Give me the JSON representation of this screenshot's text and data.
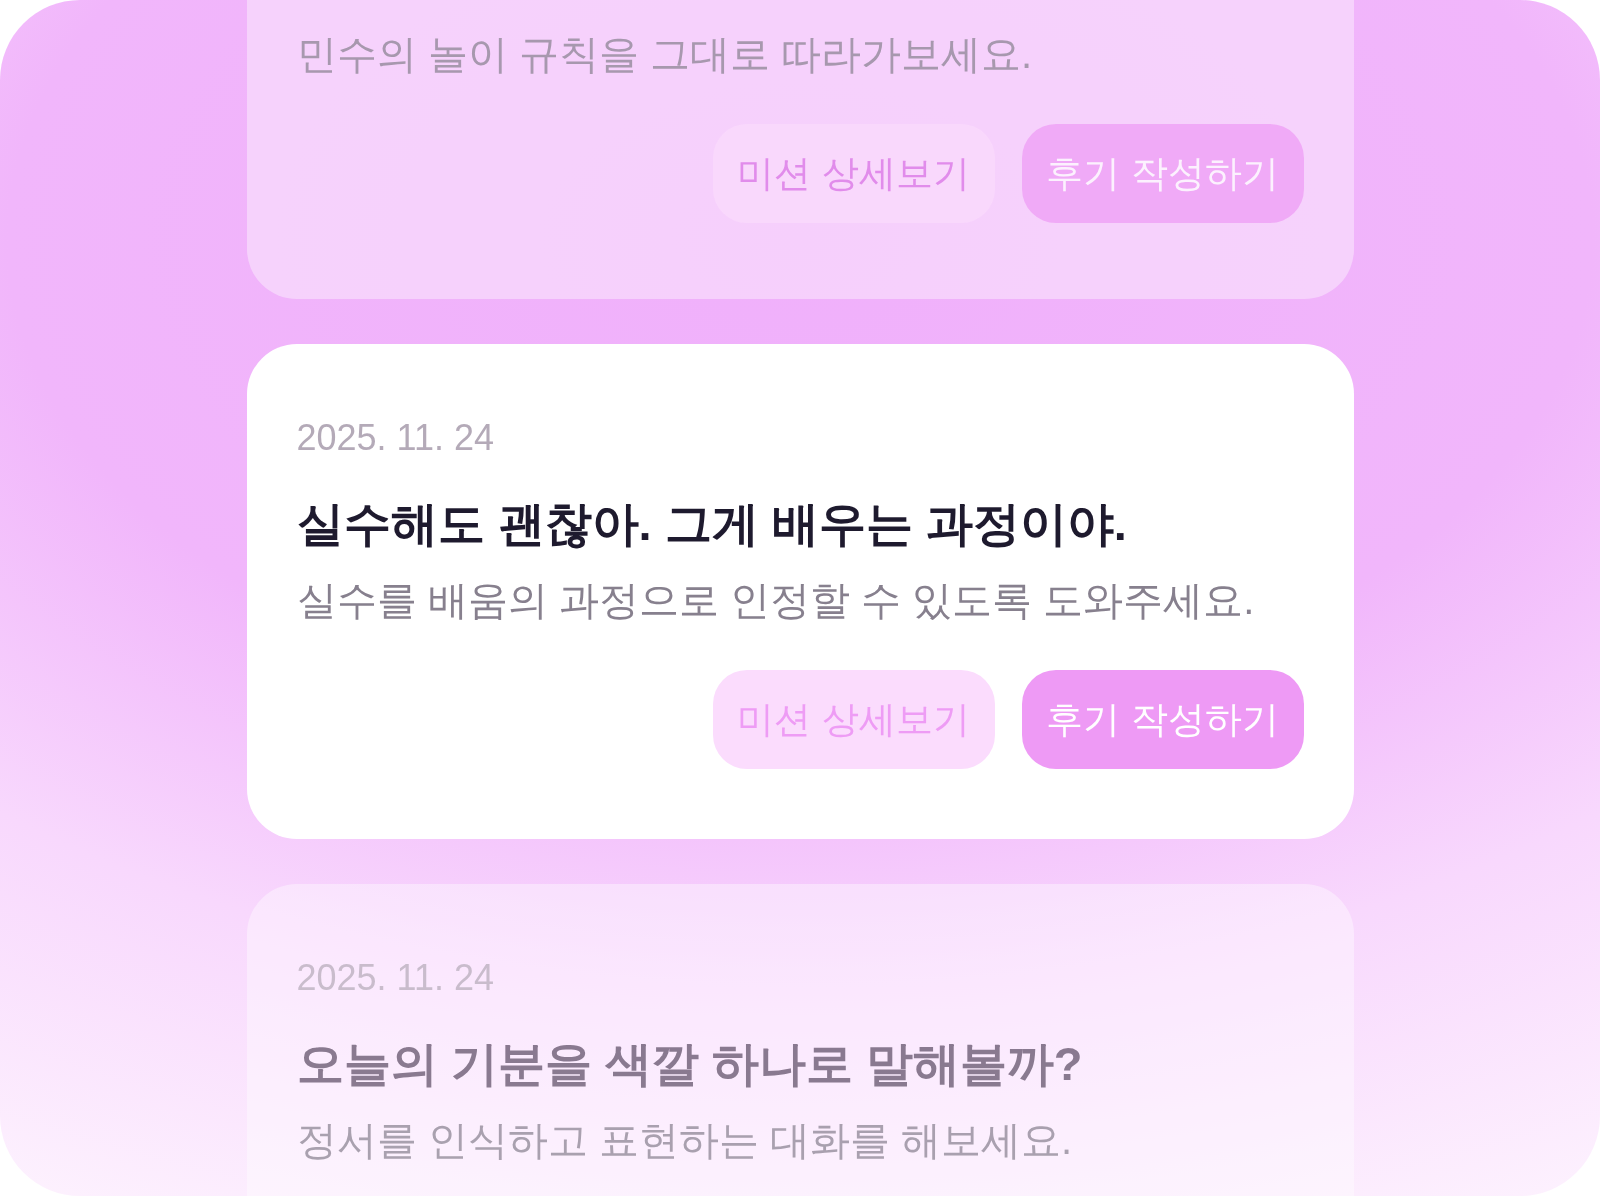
{
  "cards": [
    {
      "faded": true,
      "description": "민수의 놀이 규칙을 그대로 따라가보세요.",
      "buttons": [
        {
          "kind": "secondary",
          "label": "미션 상세보기"
        },
        {
          "kind": "primary",
          "label": "후기 작성하기"
        }
      ]
    },
    {
      "faded": false,
      "date": "2025. 11. 24",
      "title": "실수해도 괜찮아. 그게 배우는 과정이야.",
      "description": "실수를 배움의 과정으로 인정할 수 있도록 도와주세요.",
      "buttons": [
        {
          "kind": "secondary",
          "label": "미션 상세보기"
        },
        {
          "kind": "primary",
          "label": "후기 작성하기"
        }
      ]
    },
    {
      "faded": true,
      "date": "2025. 11. 24",
      "title": "오늘의 기분을 색깔 하나로 말해볼까?",
      "description": "정서를 인식하고 표현하는 대화를 해보세요."
    }
  ]
}
